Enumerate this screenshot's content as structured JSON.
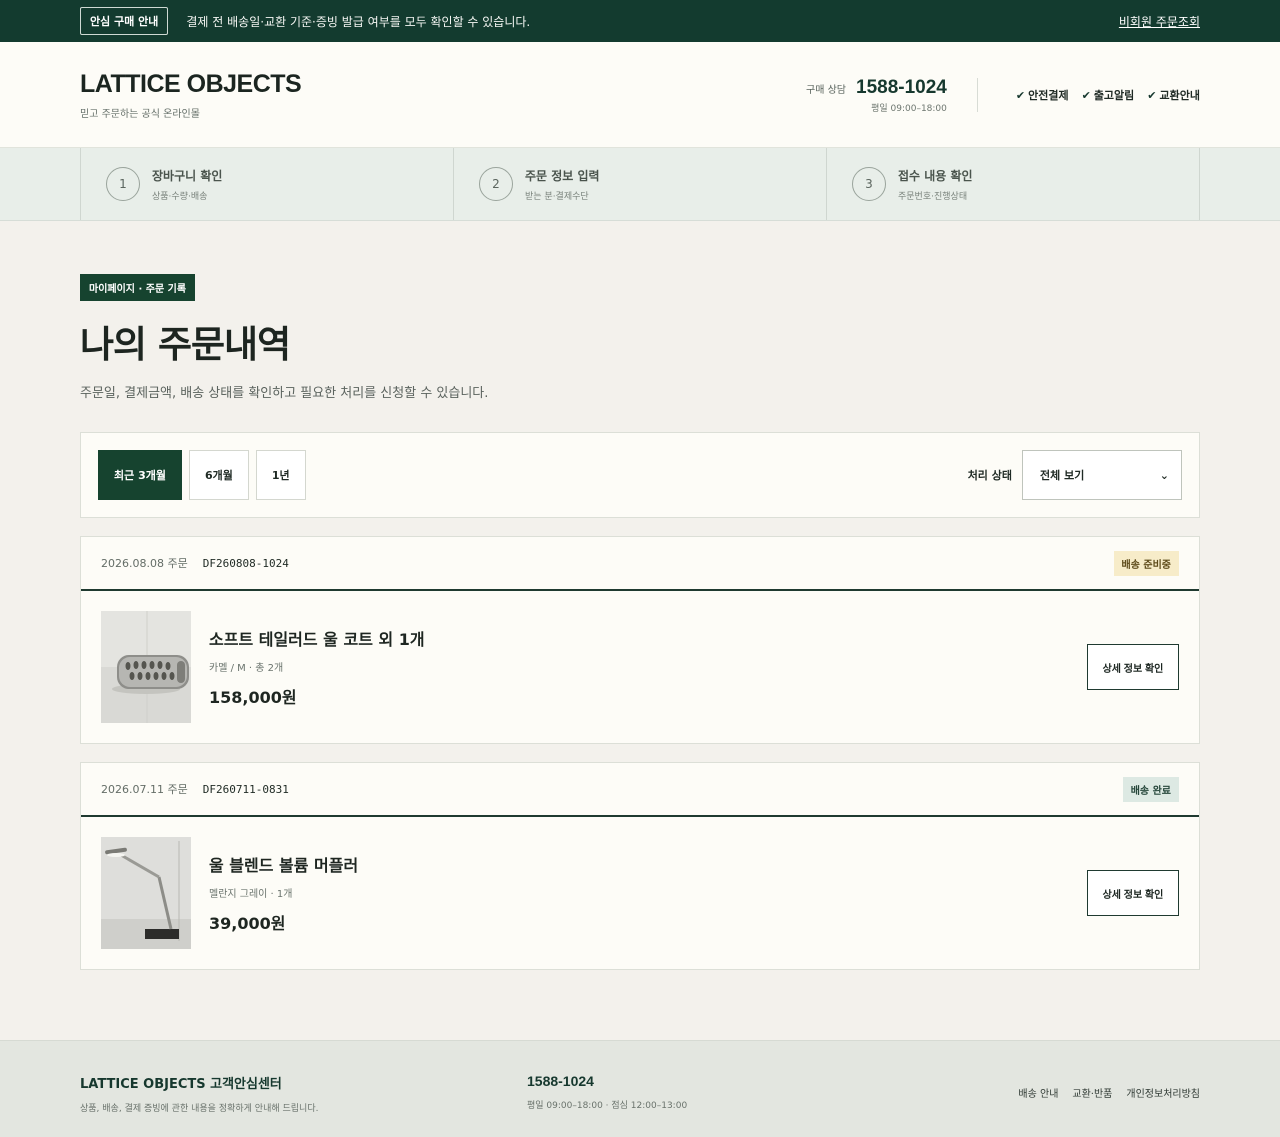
{
  "topbar": {
    "badge": "안심 구매 안내",
    "notice": "결제 전 배송일·교환 기준·증빙 발급 여부를 모두 확인할 수 있습니다.",
    "guest_link": "비회원 주문조회"
  },
  "header": {
    "logo": "LATTICE OBJECTS",
    "tagline": "믿고 주문하는 공식 온라인몰",
    "hotline_label": "구매 상담",
    "hotline_phone": "1588-1024",
    "hotline_hours": "평일 09:00–18:00",
    "assurances": [
      "안전결제",
      "출고알림",
      "교환안내"
    ],
    "check_glyph": "✔"
  },
  "steps": [
    {
      "num": "1",
      "title": "장바구니 확인",
      "sub": "상품·수량·배송"
    },
    {
      "num": "2",
      "title": "주문 정보 입력",
      "sub": "받는 분·결제수단"
    },
    {
      "num": "3",
      "title": "접수 내용 확인",
      "sub": "주문번호·진행상태"
    }
  ],
  "page": {
    "breadcrumb": "마이페이지 · 주문 기록",
    "title": "나의 주문내역",
    "description": "주문일, 결제금액, 배송 상태를 확인하고 필요한 처리를 신청할 수 있습니다."
  },
  "filter": {
    "periods": [
      "최근 3개월",
      "6개월",
      "1년"
    ],
    "active_period": "최근 3개월",
    "status_label": "처리 상태",
    "status_selected": "전체 보기",
    "chevron": "⌄"
  },
  "orders": [
    {
      "date": "2026.08.08 주문",
      "order_no": "DF260808-1024",
      "status": "배송 준비중",
      "product_name": "소프트 테일러드 울 코트 외 1개",
      "options": "카멜 / M · 총 2개",
      "price": "158,000원",
      "detail_label": "상세 정보 확인",
      "status_color": "#f7ecc9"
    },
    {
      "date": "2026.07.11 주문",
      "order_no": "DF260711-0831",
      "status": "배송 완료",
      "product_name": "울 블렌드 볼륨 머플러",
      "options": "멜란지 그레이 · 1개",
      "price": "39,000원",
      "detail_label": "상세 정보 확인",
      "status_color": "#dde9e3"
    }
  ],
  "footer": {
    "center_name": "LATTICE OBJECTS 고객안심센터",
    "center_desc": "상품, 배송, 결제 증빙에 관한 내용을 정확하게 안내해 드립니다.",
    "phone": "1588-1024",
    "hours": "평일 09:00–18:00 · 점심 12:00–13:00",
    "links": [
      "배송 안내",
      "교환·반품",
      "개인정보처리방침"
    ]
  },
  "colors": {
    "brand_dark": "#133b2f",
    "accent_green": "#16432f",
    "page_bg": "#f3f1ec"
  }
}
